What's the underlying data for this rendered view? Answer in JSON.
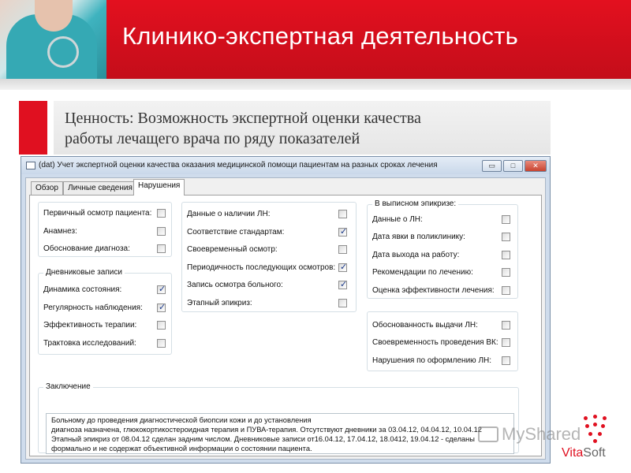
{
  "slide": {
    "title": "Клинико-экспертная деятельность",
    "value_line1": "Ценность: Возможность экспертной оценки  качества",
    "value_line2": "работы лечащего врача  по ряду показателей"
  },
  "window": {
    "title": "(dat) Учет экспертной оценки качества оказания медицинской помощи пациентам на разных сроках лечения",
    "min_glyph": "▭",
    "max_glyph": "□",
    "close_glyph": "✕"
  },
  "tabs": [
    "Обзор",
    "Личные сведения",
    "Нарушения"
  ],
  "active_tab": "Нарушения",
  "checkbox_glyph": "✓",
  "group1": {
    "items": [
      {
        "label": "Первичный осмотр пациента:",
        "checked": false
      },
      {
        "label": "Анамнез:",
        "checked": false
      },
      {
        "label": "Обоснование диагноза:",
        "checked": false
      }
    ]
  },
  "group_dnevnik": {
    "title": "Дневниковые записи",
    "items": [
      {
        "label": "Динамика состояния:",
        "checked": true
      },
      {
        "label": "Регулярность наблюдения:",
        "checked": true
      },
      {
        "label": "Эффективность терапии:",
        "checked": false
      },
      {
        "label": "Трактовка исследований:",
        "checked": false
      }
    ]
  },
  "group_middle": {
    "items": [
      {
        "label": "Данные о наличии ЛН:",
        "checked": false
      },
      {
        "label": "Соответствие стандартам:",
        "checked": true
      },
      {
        "label": "Своевременный осмотр:",
        "checked": false
      },
      {
        "label": "Периодичность последующих осмотров:",
        "checked": true
      },
      {
        "label": "Запись осмотра больного:",
        "checked": true
      },
      {
        "label": "Этапный эпикриз:",
        "checked": false
      }
    ]
  },
  "group_epicrisis": {
    "title": "В выписном эпикризе:",
    "items": [
      {
        "label": "Данные о ЛН:",
        "checked": false
      },
      {
        "label": "Дата явки в поликлинику:",
        "checked": false
      },
      {
        "label": "Дата выхода на работу:",
        "checked": false
      },
      {
        "label": "Рекомендации по лечению:",
        "checked": false
      },
      {
        "label": "Оценка эффективности лечения:",
        "checked": false
      }
    ]
  },
  "group_ln": {
    "items": [
      {
        "label": "Обоснованность выдачи ЛН:",
        "checked": false
      },
      {
        "label": "Своевременность проведения ВК:",
        "checked": false
      },
      {
        "label": "Нарушения по оформлению ЛН:",
        "checked": false
      }
    ]
  },
  "conclusion": {
    "title": "Заключение",
    "lines": [
      "Больному до проведения диагностической биопсии кожи и до установления",
      "диагноза назначена, глюкокортикостероидная терапия и ПУВА-терапия. Отсутствуют дневники за 03.04.12, 04.04.12, 10.04.12",
      "Этапный эпикриз от 08.04.12 сделан задним числом. Дневниковые записи от16.04.12, 17.04.12, 18.0412, 19.04.12 - сделаны",
      "формально и не содержат объективной информации о состоянии пациента."
    ]
  },
  "watermark": "MyShared",
  "logo": {
    "vita": "Vita",
    "soft": "Soft"
  },
  "colors": {
    "brand_red": "#e01020",
    "check_blue": "#1b3a8a"
  }
}
